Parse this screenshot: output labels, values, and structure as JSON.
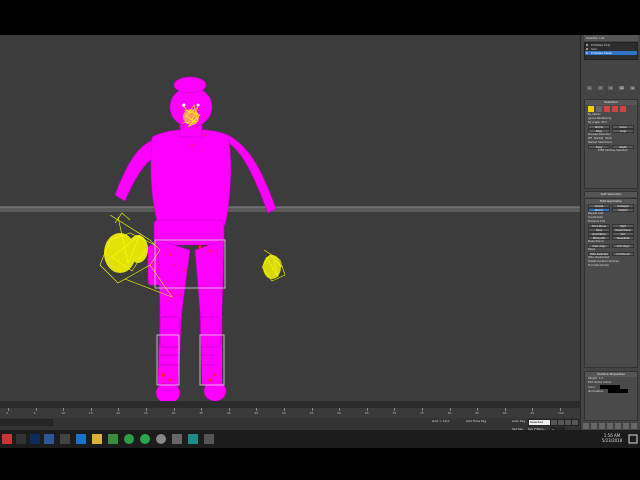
{
  "command_panel": {
    "modifier_list_label": "Modifier List",
    "stack": [
      {
        "label": "Editable Poly"
      },
      {
        "label": "Skin"
      },
      {
        "label": "Editable Mesh"
      }
    ],
    "selection": {
      "title": "Selection",
      "by_vertex": "By Vertex",
      "ignore_backfacing": "Ignore Backfacing",
      "by_angle": "By Angle:",
      "by_angle_value": "45.0",
      "shrink": "Shrink",
      "grow": "Grow",
      "ring": "Ring",
      "loop": "Loop",
      "preview": "Preview Selection",
      "off": "Off",
      "subobj": "SubObj",
      "multi": "Multi",
      "status": "3358 Vertices Selected"
    },
    "soft_selection": {
      "title": "Soft Selection"
    },
    "edit_geometry": {
      "title": "Edit Geometry",
      "repeat_last": "Repeat Last",
      "constraints": "Constraints",
      "preserve_uvs": "Preserve UVs",
      "create": "Create",
      "collapse": "Collapse",
      "attach": "Attach",
      "detach": "Detach",
      "slice_plane": "Slice Plane",
      "split": "Split",
      "slice": "Slice",
      "reset_plane": "Reset Plane",
      "quickslice": "QuickSlice",
      "cut": "Cut",
      "msmooth": "MSmooth",
      "tessellate": "Tessellate",
      "make_planar": "Make Planar",
      "view_align": "View Align",
      "grid_align": "Grid Align",
      "relax": "Relax",
      "hide_selected": "Hide Selected",
      "unhide_all": "Unhide All",
      "hide_unselected": "Hide Unselected",
      "named_selections": "Named Selections:",
      "copy": "Copy",
      "paste": "Paste",
      "delete_isolated": "Delete Isolated Vertices",
      "full_interactivity": "Full Interactivity"
    },
    "surface_properties": {
      "title": "Surface Properties",
      "weight_label": "Weight:",
      "weight_value": "1.0",
      "edit_vertex_colors": "Edit Vertex Colors",
      "color_label": "Color:",
      "illumination_label": "Illumination:"
    }
  },
  "timeline": {
    "ticks": [
      "0",
      "5",
      "10",
      "15",
      "20",
      "25",
      "30",
      "35",
      "40",
      "45",
      "50",
      "55",
      "60",
      "65",
      "70",
      "75",
      "80",
      "85",
      "90",
      "95",
      "100"
    ]
  },
  "statusbar": {
    "grid_label": "Grid = 10.0",
    "auto_key": "Auto Key",
    "selected": "Selected",
    "set_key": "Set Key",
    "key_filters": "Key Filters...",
    "add_time_tag": "Add Time Tag",
    "frame": "0"
  },
  "taskbar": {
    "time": "1:56 AM",
    "date": "5/23/2018"
  },
  "colors": {
    "mesh": "#ff00ff",
    "bones": "#ffff00",
    "selection_dots": "#ff2020"
  }
}
